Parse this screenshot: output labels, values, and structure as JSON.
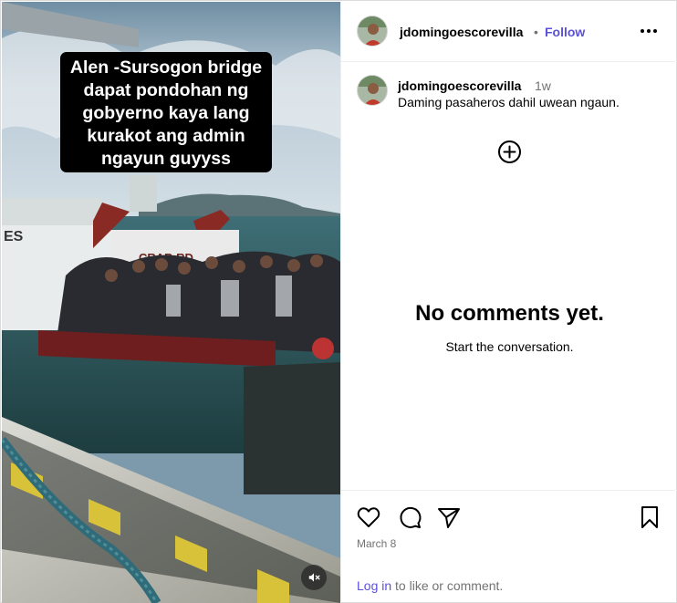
{
  "media": {
    "caption_lines": [
      "Alen -Sursogon bridge",
      "dapat pondohan ng",
      "gobyerno kaya lang",
      "kurakot ang admin",
      "ngayun guyyss"
    ],
    "ship_text_left": "ES",
    "ship_text_right": "CRAB RD",
    "mute_icon": "speaker-muted-icon"
  },
  "header": {
    "username": "jdomingoescorevilla",
    "separator": "•",
    "follow_label": "Follow",
    "more_icon": "more-horizontal-icon"
  },
  "caption_comment": {
    "username": "jdomingoescorevilla",
    "age": "1w",
    "text": "Daming pasaheros dahil uwean ngaun."
  },
  "comments": {
    "add_icon": "add-circle-icon",
    "empty_title": "No comments yet.",
    "empty_subtitle": "Start the conversation."
  },
  "actions": {
    "like_icon": "heart-icon",
    "comment_icon": "comment-bubble-icon",
    "share_icon": "share-send-icon",
    "save_icon": "bookmark-icon",
    "date": "March 8",
    "login_link": "Log in",
    "login_suffix": " to like or comment."
  },
  "colors": {
    "link": "#5b51d8",
    "muted_text": "#737373",
    "divider": "#efefef"
  }
}
